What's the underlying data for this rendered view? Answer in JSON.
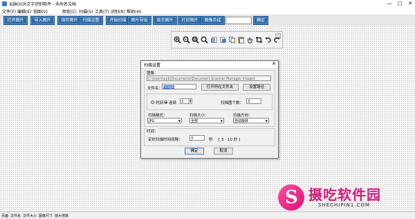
{
  "window": {
    "title": "云脉OCR文字识别软件 - 未命名文档"
  },
  "menubar": {
    "items": [
      "文件(F)",
      "编辑(E)",
      "视图(V)",
      "颜色(C)",
      "扫描(S)",
      "工具(T)",
      "识别(R)",
      "帮助(H)"
    ]
  },
  "toolbar": {
    "buttons": [
      "打开图片",
      "导入图片",
      "保存图片",
      "扫描设置",
      "开始扫描",
      "图片导出",
      "显示图片",
      "打印图片",
      "图像合成"
    ],
    "go_label": "确定"
  },
  "dialog": {
    "title": "扫描设置",
    "image_group_label": "图像：",
    "path_value": "C:\\Users\\xyb\\Documents\\Document Scanner Manager Images",
    "filename_label": "文件名：",
    "filename_value": "Image",
    "open_folder_label": "打开所在文件夹",
    "set_path_label": "设置路径",
    "mode_timer_label": "时间",
    "mode_continuous_label": "连续",
    "spin_value": "1",
    "count_label": "扫描图个数：",
    "count_value": "3",
    "format_label": "扫描格式：",
    "format_value": "JPG",
    "size_label": "扫描大小：",
    "size_value": "全部",
    "direction_label": "扫描方向：",
    "direction_value": "自动旋转",
    "time_group_label": "时间：",
    "interval_label": "定时扫描时间间隔：",
    "interval_value": "3",
    "seconds_label": "秒",
    "range_label": "[ 3 - 10 秒 ]",
    "ok_label": "确定",
    "cancel_label": "取消"
  },
  "statusbar": {
    "items": [
      "页面",
      "文件名",
      "文件大小",
      "图像尺寸",
      "放大倍数"
    ]
  },
  "watermark": {
    "cn_text": "摄吃软件园",
    "url_text": "SHECHIPIN1.COM"
  },
  "icons": [
    "zoom-in-icon",
    "zoom-out-icon",
    "zoom-fit-icon",
    "zoom-actual-icon",
    "rotate-left-icon",
    "rotate-right-icon",
    "copy-icon",
    "paste-icon",
    "hand-icon",
    "crop-icon",
    "undo-icon",
    "redo-icon"
  ],
  "colors": {
    "toolbar_button": "#2d6ca8",
    "selection": "#3b6fd0",
    "watermark": "#d61c7a"
  }
}
